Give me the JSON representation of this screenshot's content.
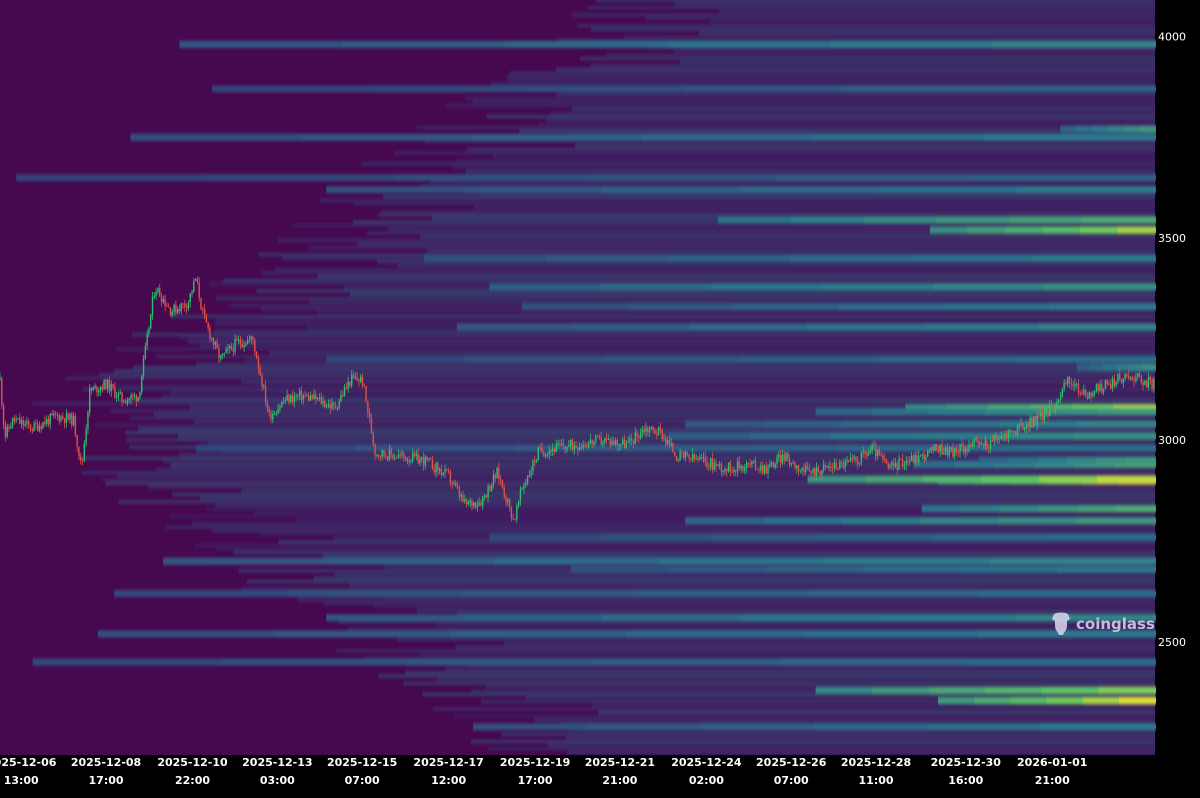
{
  "chart_data": {
    "type": "heatmap",
    "title": "",
    "xlabel": "",
    "ylabel": "",
    "ylim": [
      2220,
      4090
    ],
    "y_ticks": [
      "4000",
      "3500",
      "3000",
      "2500"
    ],
    "y_tick_values": [
      4000,
      3500,
      3000,
      2500
    ],
    "x_ticks": [
      {
        "date": "2025-12-06",
        "time": "13:00"
      },
      {
        "date": "2025-12-08",
        "time": "17:00"
      },
      {
        "date": "2025-12-10",
        "time": "22:00"
      },
      {
        "date": "2025-12-13",
        "time": "03:00"
      },
      {
        "date": "2025-12-15",
        "time": "07:00"
      },
      {
        "date": "2025-12-17",
        "time": "12:00"
      },
      {
        "date": "2025-12-19",
        "time": "17:00"
      },
      {
        "date": "2025-12-21",
        "time": "21:00"
      },
      {
        "date": "2025-12-24",
        "time": "02:00"
      },
      {
        "date": "2025-12-26",
        "time": "07:00"
      },
      {
        "date": "2025-12-28",
        "time": "11:00"
      },
      {
        "date": "2025-12-30",
        "time": "16:00"
      },
      {
        "date": "2026-01-01",
        "time": "21:00"
      }
    ],
    "x_tick_hours": [
      13,
      65,
      118,
      170,
      222,
      275,
      328,
      380,
      433,
      485,
      537,
      592,
      645
    ],
    "x_range_hours": [
      0,
      708
    ],
    "price_path": [
      [
        0,
        3150
      ],
      [
        3,
        3010
      ],
      [
        8,
        3050
      ],
      [
        20,
        3030
      ],
      [
        35,
        3060
      ],
      [
        45,
        3050
      ],
      [
        50,
        2930
      ],
      [
        55,
        3120
      ],
      [
        65,
        3140
      ],
      [
        75,
        3100
      ],
      [
        85,
        3110
      ],
      [
        95,
        3380
      ],
      [
        105,
        3320
      ],
      [
        115,
        3340
      ],
      [
        120,
        3400
      ],
      [
        125,
        3300
      ],
      [
        135,
        3200
      ],
      [
        145,
        3240
      ],
      [
        155,
        3250
      ],
      [
        165,
        3060
      ],
      [
        175,
        3100
      ],
      [
        185,
        3110
      ],
      [
        195,
        3100
      ],
      [
        205,
        3080
      ],
      [
        215,
        3150
      ],
      [
        222,
        3150
      ],
      [
        230,
        2970
      ],
      [
        245,
        2960
      ],
      [
        260,
        2950
      ],
      [
        275,
        2910
      ],
      [
        285,
        2840
      ],
      [
        295,
        2850
      ],
      [
        305,
        2920
      ],
      [
        315,
        2800
      ],
      [
        320,
        2880
      ],
      [
        330,
        2970
      ],
      [
        340,
        2980
      ],
      [
        355,
        2990
      ],
      [
        370,
        3000
      ],
      [
        385,
        2990
      ],
      [
        395,
        3030
      ],
      [
        405,
        3020
      ],
      [
        415,
        2960
      ],
      [
        430,
        2950
      ],
      [
        445,
        2930
      ],
      [
        460,
        2940
      ],
      [
        470,
        2930
      ],
      [
        480,
        2960
      ],
      [
        495,
        2920
      ],
      [
        505,
        2930
      ],
      [
        515,
        2940
      ],
      [
        525,
        2950
      ],
      [
        535,
        2980
      ],
      [
        545,
        2930
      ],
      [
        555,
        2950
      ],
      [
        565,
        2960
      ],
      [
        575,
        2980
      ],
      [
        585,
        2970
      ],
      [
        595,
        2990
      ],
      [
        605,
        2990
      ],
      [
        620,
        3020
      ],
      [
        635,
        3050
      ],
      [
        645,
        3080
      ],
      [
        655,
        3150
      ],
      [
        665,
        3110
      ],
      [
        675,
        3130
      ],
      [
        685,
        3150
      ],
      [
        695,
        3160
      ],
      [
        705,
        3140
      ]
    ],
    "liquidity_levels": [
      {
        "price": 2900,
        "start": 575,
        "intensity": 1.0
      },
      {
        "price": 2903,
        "start": 495,
        "intensity": 0.9
      },
      {
        "price": 2355,
        "start": 575,
        "intensity": 0.95
      },
      {
        "price": 2380,
        "start": 500,
        "intensity": 0.8
      },
      {
        "price": 3520,
        "start": 570,
        "intensity": 0.85
      },
      {
        "price": 3545,
        "start": 440,
        "intensity": 0.6
      },
      {
        "price": 3080,
        "start": 555,
        "intensity": 0.85
      },
      {
        "price": 3070,
        "start": 500,
        "intensity": 0.5
      },
      {
        "price": 2830,
        "start": 565,
        "intensity": 0.6
      },
      {
        "price": 2800,
        "start": 420,
        "intensity": 0.5
      },
      {
        "price": 2940,
        "start": 560,
        "intensity": 0.55
      },
      {
        "price": 2950,
        "start": 600,
        "intensity": 0.5
      },
      {
        "price": 3010,
        "start": 410,
        "intensity": 0.45
      },
      {
        "price": 3040,
        "start": 420,
        "intensity": 0.4
      },
      {
        "price": 3180,
        "start": 660,
        "intensity": 0.45
      },
      {
        "price": 3280,
        "start": 280,
        "intensity": 0.4
      },
      {
        "price": 3380,
        "start": 300,
        "intensity": 0.45
      },
      {
        "price": 3450,
        "start": 260,
        "intensity": 0.35
      },
      {
        "price": 3620,
        "start": 200,
        "intensity": 0.35
      },
      {
        "price": 3750,
        "start": 80,
        "intensity": 0.35
      },
      {
        "price": 3770,
        "start": 650,
        "intensity": 0.5
      },
      {
        "price": 3980,
        "start": 110,
        "intensity": 0.4
      },
      {
        "price": 2700,
        "start": 100,
        "intensity": 0.4
      },
      {
        "price": 2680,
        "start": 350,
        "intensity": 0.35
      },
      {
        "price": 2620,
        "start": 70,
        "intensity": 0.3
      },
      {
        "price": 2560,
        "start": 200,
        "intensity": 0.4
      },
      {
        "price": 2520,
        "start": 60,
        "intensity": 0.35
      },
      {
        "price": 2450,
        "start": 20,
        "intensity": 0.3
      },
      {
        "price": 2290,
        "start": 290,
        "intensity": 0.35
      },
      {
        "price": 3200,
        "start": 200,
        "intensity": 0.3
      },
      {
        "price": 3330,
        "start": 320,
        "intensity": 0.35
      },
      {
        "price": 2760,
        "start": 300,
        "intensity": 0.3
      },
      {
        "price": 3650,
        "start": 10,
        "intensity": 0.25
      },
      {
        "price": 3870,
        "start": 130,
        "intensity": 0.25
      },
      {
        "price": 2980,
        "start": 120,
        "intensity": 0.3
      }
    ]
  },
  "watermark": {
    "text": "coinglass"
  },
  "colors": {
    "background": "#46084f",
    "low": "#3b2170",
    "mid": "#2a7a8e",
    "high": "#5ec962",
    "peak": "#fde725",
    "candle_up": "#2fbf71",
    "candle_down": "#e0524a"
  }
}
